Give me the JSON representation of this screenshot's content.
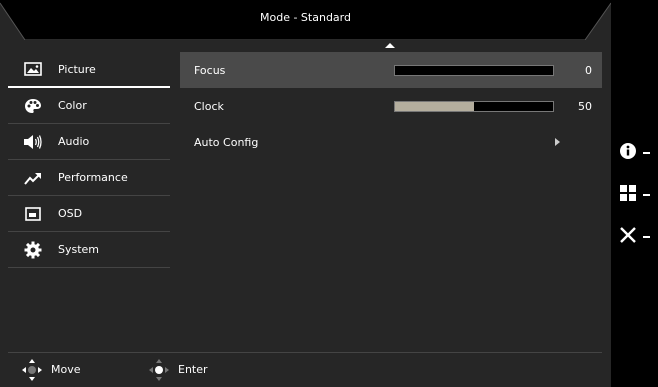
{
  "header": {
    "title": "Mode - Standard"
  },
  "sidebar": {
    "items": [
      {
        "label": "Picture",
        "icon": "picture-icon",
        "active": true
      },
      {
        "label": "Color",
        "icon": "palette-icon"
      },
      {
        "label": "Audio",
        "icon": "speaker-icon"
      },
      {
        "label": "Performance",
        "icon": "trend-icon"
      },
      {
        "label": "OSD",
        "icon": "osd-window-icon"
      },
      {
        "label": "System",
        "icon": "gear-icon"
      }
    ]
  },
  "content": {
    "rows": [
      {
        "label": "Focus",
        "value": "0",
        "level": 0
      },
      {
        "label": "Clock",
        "value": "50",
        "level": 0.5
      },
      {
        "label": "Auto Config"
      }
    ]
  },
  "footer": {
    "move_label": "Move",
    "enter_label": "Enter"
  },
  "side_buttons": [
    "info-icon",
    "grid-icon",
    "close-icon"
  ],
  "colors": {
    "background": "#262626",
    "selected_row": "#4a4a4a",
    "bar_fill": "#b4ae9e"
  }
}
